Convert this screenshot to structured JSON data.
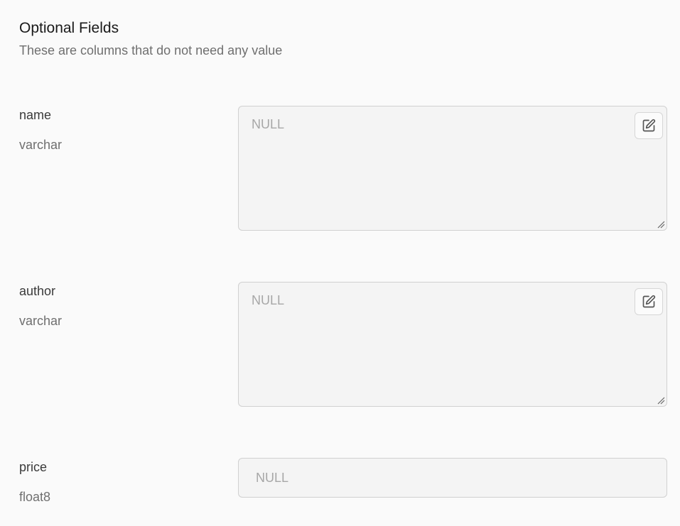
{
  "section": {
    "title": "Optional Fields",
    "subtitle": "These are columns that do not need any value"
  },
  "fields": [
    {
      "name": "name",
      "type": "varchar",
      "placeholder": "NULL"
    },
    {
      "name": "author",
      "type": "varchar",
      "placeholder": "NULL"
    },
    {
      "name": "price",
      "type": "float8",
      "placeholder": "NULL"
    }
  ],
  "icons": {
    "expand_editor": "edit-icon",
    "resize": "resize-handle-icon"
  },
  "colors": {
    "background": "#fafafa",
    "input_background": "#f4f4f4",
    "input_border": "#d0d0d0",
    "placeholder": "#a7a7a7",
    "label": "#3a3a3a",
    "secondary_text": "#6f6f6f"
  }
}
